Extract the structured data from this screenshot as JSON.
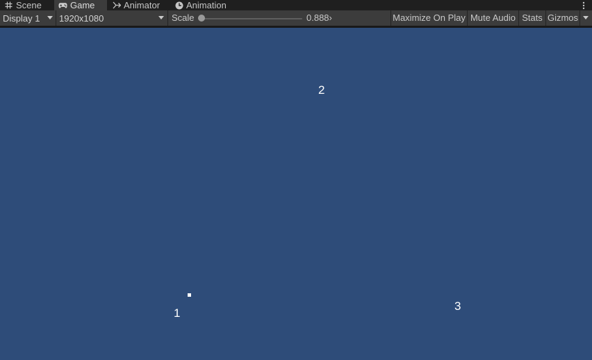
{
  "tabs": [
    {
      "id": "scene",
      "label": "Scene",
      "icon": "grid-hash-icon",
      "active": false
    },
    {
      "id": "game",
      "label": "Game",
      "icon": "gamepad-icon",
      "active": true
    },
    {
      "id": "animator",
      "label": "Animator",
      "icon": "animator-icon",
      "active": false
    },
    {
      "id": "animation",
      "label": "Animation",
      "icon": "clock-icon",
      "active": false
    }
  ],
  "toolbar": {
    "display_label": "Display 1",
    "resolution_label": "1920x1080",
    "scale_label": "Scale",
    "scale_value": "0.888›",
    "scale_fraction": 0.0,
    "maximize_label": "Maximize On Play",
    "mute_label": "Mute Audio",
    "stats_label": "Stats",
    "gizmos_label": "Gizmos"
  },
  "game": {
    "background_color": "#2e4c79",
    "waypoints": [
      {
        "label": "1"
      },
      {
        "label": "2"
      },
      {
        "label": "3"
      }
    ]
  },
  "colors": {
    "tab_bar": "#1f1f1f",
    "toolbar": "#3c3c3c",
    "text": "#c8c8c8"
  }
}
